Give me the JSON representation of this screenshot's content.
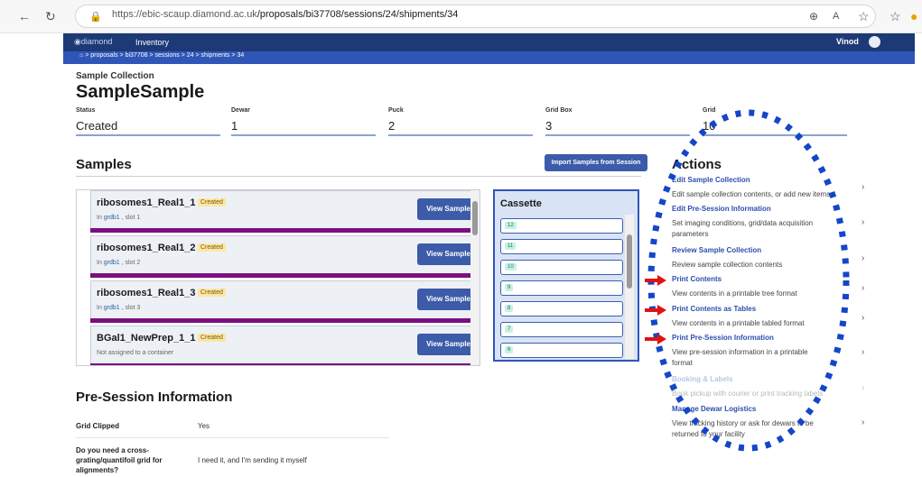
{
  "browser": {
    "url_host": "https://ebic-scaup.diamond.ac.uk",
    "url_path": "/proposals/bi37708/sessions/24/shipments/34"
  },
  "navbar": {
    "logo_text": "diamond",
    "inventory_label": "Inventory",
    "user_name": "Vinod"
  },
  "breadcrumb": {
    "home_icon": "home-icon",
    "items": [
      "proposals",
      "bi37708",
      "sessions",
      "24",
      "shipments",
      "34"
    ]
  },
  "header": {
    "kicker": "Sample Collection",
    "title": "SampleSample"
  },
  "fields": [
    {
      "label": "Status",
      "value": "Created"
    },
    {
      "label": "Dewar",
      "value": "1"
    },
    {
      "label": "Puck",
      "value": "2"
    },
    {
      "label": "Grid Box",
      "value": "3"
    },
    {
      "label": "Grid",
      "value": "10"
    }
  ],
  "samples": {
    "heading": "Samples",
    "import_button": "Import Samples from Session",
    "view_label": "View Sample",
    "items": [
      {
        "name": "ribosomes1_Real1_1",
        "status": "Created",
        "prefix": "In ",
        "container": "grdb1",
        "suffix": " , slot 1"
      },
      {
        "name": "ribosomes1_Real1_2",
        "status": "Created",
        "prefix": "In ",
        "container": "grdb1",
        "suffix": " , slot 2"
      },
      {
        "name": "ribosomes1_Real1_3",
        "status": "Created",
        "prefix": "In ",
        "container": "grdb1",
        "suffix": " , slot 3"
      },
      {
        "name": "BGal1_NewPrep_1_1",
        "status": "Created",
        "prefix": "",
        "container": "",
        "suffix": "Not assigned to a container"
      }
    ]
  },
  "cassette": {
    "title": "Cassette",
    "slots": [
      "12",
      "11",
      "10",
      "9",
      "8",
      "7",
      "6"
    ]
  },
  "actions": {
    "heading": "Actions",
    "items": [
      {
        "title": "Edit Sample Collection",
        "desc": [
          "Edit sample collection contents, or add new items"
        ]
      },
      {
        "title": "Edit Pre-Session Information",
        "desc": [
          "Set imaging conditions, grid/data acquisition",
          "parameters"
        ]
      },
      {
        "title": "Review Sample Collection",
        "desc": [
          "Review sample collection contents"
        ]
      },
      {
        "title": "Print Contents",
        "desc": [
          "View contents in a printable tree format"
        ]
      },
      {
        "title": "Print Contents as Tables",
        "desc": [
          "View contents in a printable tabled format"
        ]
      },
      {
        "title": "Print Pre-Session Information",
        "desc": [
          "View pre-session information in a printable",
          "format"
        ]
      },
      {
        "title": "Booking & Labels",
        "desc": [
          "Book pickup with courier or print tracking labels"
        ],
        "disabled": true
      },
      {
        "title": "Manage Dewar Logistics",
        "desc": [
          "View tracking history or ask for dewars to be",
          "returned to your facility"
        ]
      }
    ]
  },
  "presession": {
    "heading": "Pre-Session Information",
    "rows": [
      {
        "label": [
          "Grid Clipped"
        ],
        "value": "Yes"
      },
      {
        "label": [
          "Do you need a cross-",
          "grating/quantifoil grid for",
          "alignments?"
        ],
        "value": "I need it, and I'm sending it myself"
      }
    ]
  },
  "colors": {
    "navbar": "#1d3a77",
    "breadcrumb_bar": "#2f56b7",
    "primary_button": "#3c5ba9",
    "sample_bar": "#7a0f80",
    "annotation_blue": "#1446c8",
    "annotation_red": "#e01212"
  }
}
